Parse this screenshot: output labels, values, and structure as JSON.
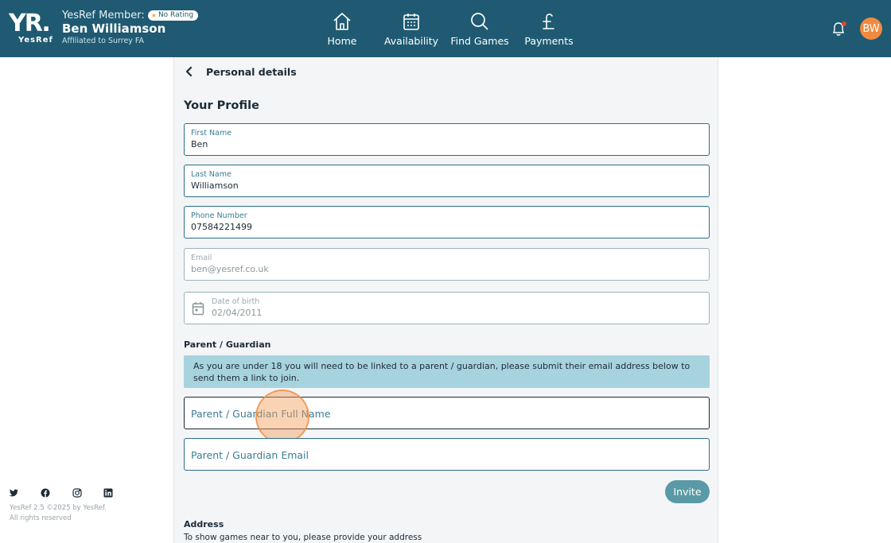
{
  "header": {
    "logo_text": "YR.",
    "logo_sub": "YesRef",
    "member_label": "YesRef Member:",
    "rating_badge": "No Rating",
    "member_name": "Ben Williamson",
    "affiliation": "Affiliated to Surrey FA",
    "nav": [
      {
        "label": "Home",
        "icon": "home-icon"
      },
      {
        "label": "Availability",
        "icon": "calendar-icon"
      },
      {
        "label": "Find Games",
        "icon": "search-icon"
      },
      {
        "label": "Payments",
        "icon": "pound-icon"
      }
    ],
    "avatar_initials": "BW",
    "colors": {
      "bar": "#1f5a72",
      "avatar": "#f08a3e",
      "accent": "#2a6f88"
    }
  },
  "page": {
    "back_title": "Personal details",
    "section_title": "Your Profile",
    "fields": {
      "first_name": {
        "label": "First Name",
        "value": "Ben"
      },
      "last_name": {
        "label": "Last Name",
        "value": "Williamson"
      },
      "phone": {
        "label": "Phone Number",
        "value": "07584221499"
      },
      "email": {
        "label": "Email",
        "value": "ben@yesref.co.uk"
      },
      "dob": {
        "label": "Date of birth",
        "value": "02/04/2011"
      }
    },
    "guardian": {
      "title": "Parent / Guardian",
      "notice": "As you are under 18 you will need to be linked to a parent / guardian, please submit their email address below to send them a link to join.",
      "name_placeholder": "Parent / Guardian Full Name",
      "email_placeholder": "Parent / Guardian Email",
      "invite_label": "Invite"
    },
    "address": {
      "title": "Address",
      "text": "To show games near to you, please provide your address"
    }
  },
  "footer": {
    "social": [
      "twitter-icon",
      "facebook-icon",
      "instagram-icon",
      "linkedin-icon"
    ],
    "version": "YesRef 2.5 ©2025 by YesRef.",
    "rights": "All rights reserved"
  }
}
